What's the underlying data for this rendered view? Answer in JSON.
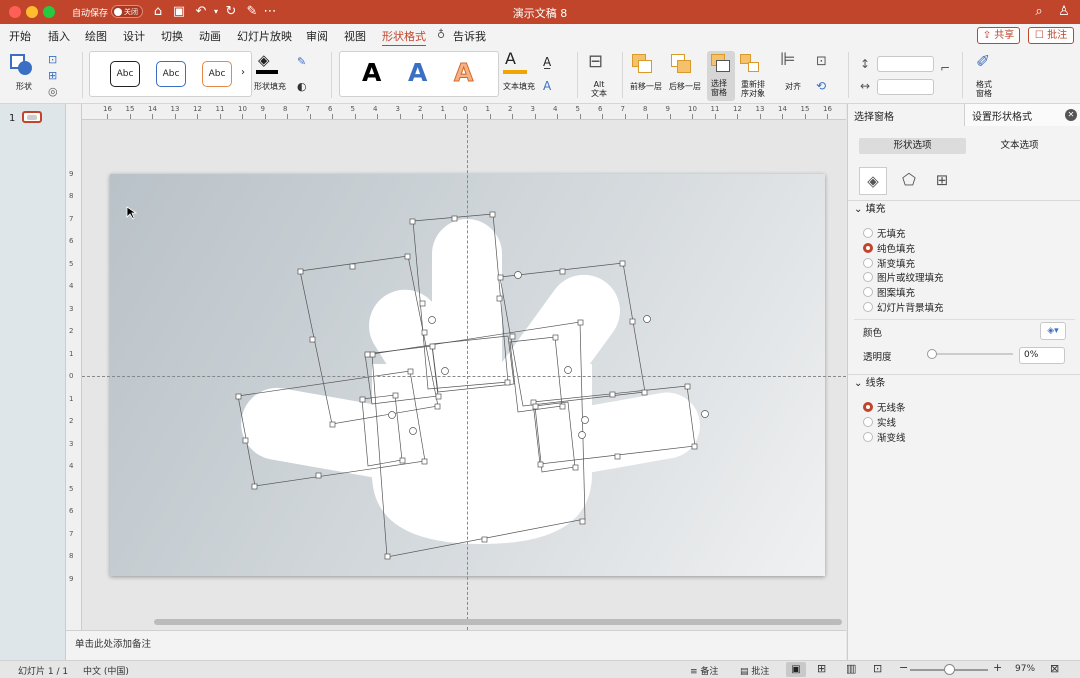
{
  "window": {
    "autosave_label": "自动保存",
    "autosave_state": "关闭",
    "title": "演示文稿 8"
  },
  "titlebar_actions": {
    "share": "共享",
    "comments": "批注"
  },
  "menu": [
    "开始",
    "插入",
    "绘图",
    "设计",
    "切换",
    "动画",
    "幻灯片放映",
    "审阅",
    "视图",
    "形状格式",
    "告诉我"
  ],
  "active_menu": "形状格式",
  "ribbon": {
    "shapes": "形状",
    "style_samples": [
      "Abc",
      "Abc",
      "Abc"
    ],
    "shape_fill": "形状填充",
    "wordart_samples": [
      "A",
      "A",
      "A"
    ],
    "text_fill": "文本填充",
    "alt_text": "Alt\n文本",
    "bring_forward": "前移一层",
    "send_backward": "后移一层",
    "selection_pane": "选择\n窗格",
    "reorder": "重新排\n序对象",
    "align": "对齐",
    "format_pane": "格式\n窗格"
  },
  "thumbnail": {
    "number": "1"
  },
  "ruler": {
    "top": [
      "16",
      "15",
      "14",
      "13",
      "12",
      "11",
      "10",
      "9",
      "8",
      "7",
      "6",
      "5",
      "4",
      "3",
      "2",
      "1",
      "0",
      "1",
      "2",
      "3",
      "4",
      "5",
      "6",
      "7",
      "8",
      "9",
      "10",
      "11",
      "12",
      "13",
      "14",
      "15",
      "16"
    ],
    "left": [
      "9",
      "8",
      "7",
      "6",
      "5",
      "4",
      "3",
      "2",
      "1",
      "0",
      "1",
      "2",
      "3",
      "4",
      "5",
      "6",
      "7",
      "8",
      "9"
    ]
  },
  "pane": {
    "tab_selection": "选择窗格",
    "tab_format": "设置形状格式",
    "shape_options": "形状选项",
    "text_options": "文本选项",
    "fill_header": "填充",
    "fill_options": [
      "无填充",
      "纯色填充",
      "渐变填充",
      "图片或纹理填充",
      "图案填充",
      "幻灯片背景填充"
    ],
    "fill_selected": "纯色填充",
    "color_label": "颜色",
    "transparency_label": "透明度",
    "transparency_value": "0%",
    "line_header": "线条",
    "line_options": [
      "无线条",
      "实线",
      "渐变线"
    ],
    "line_selected": "无线条"
  },
  "notes_placeholder": "单击此处添加备注",
  "status": {
    "slide": "幻灯片 1 / 1",
    "language": "中文 (中国)",
    "notes": "备注",
    "comments": "批注",
    "zoom": "97%"
  },
  "colors": {
    "accent": "#c0452b",
    "titlebar": "#c0452b",
    "slide_shape": "#ffffff"
  }
}
